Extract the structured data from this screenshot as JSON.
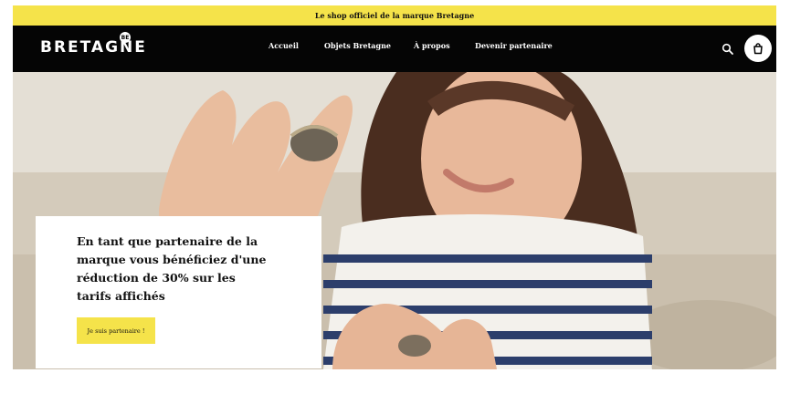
{
  "announcement": {
    "text": "Le shop officiel de la marque Bretagne"
  },
  "header": {
    "logo_text": "BRETAGNE",
    "logo_badge": "BE",
    "nav": [
      {
        "label": "Accueil"
      },
      {
        "label": "Objets Bretagne"
      },
      {
        "label": "À propos"
      },
      {
        "label": "Devenir partenaire"
      }
    ],
    "icons": {
      "search": "search-icon",
      "cart": "shopping-bag-icon"
    }
  },
  "hero": {
    "image": "girl-holding-seashell-photo",
    "promo": {
      "text": "En tant que partenaire de la marque vous bénéficiez d'une réduction de 30% sur les tarifs affichés",
      "button_label": "Je suis partenaire !"
    }
  },
  "colors": {
    "accent": "#f5e34a",
    "header_bg": "#050505",
    "page_bg": "#ffffff"
  }
}
